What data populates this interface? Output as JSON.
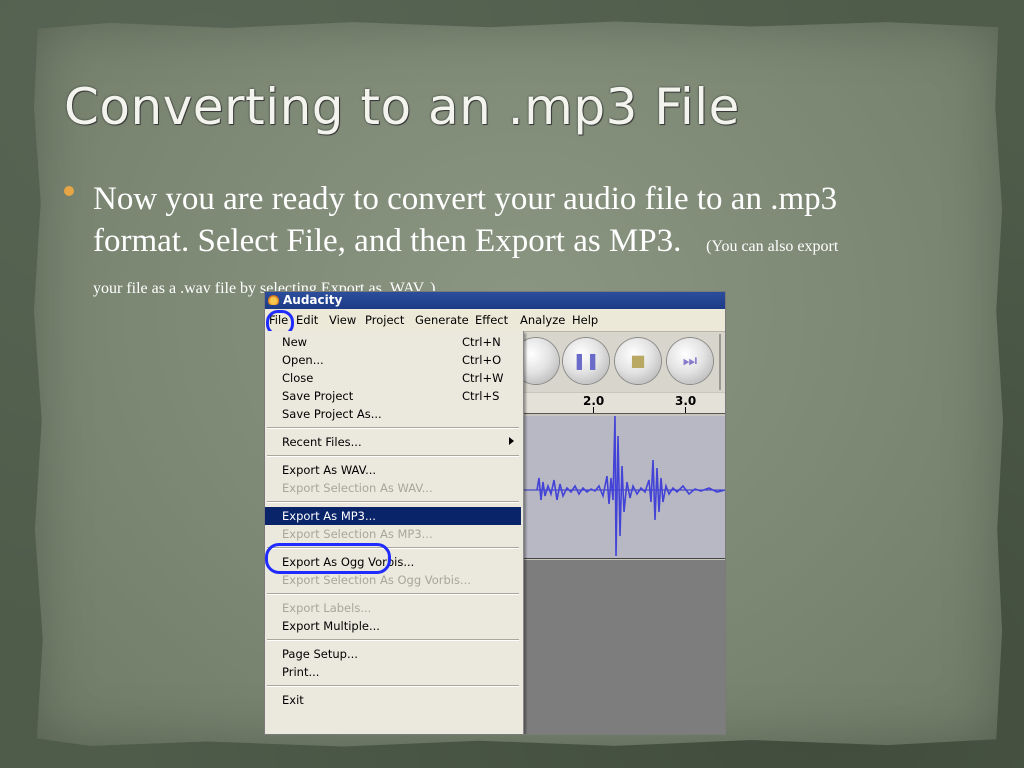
{
  "slide": {
    "title": "Converting to an .mp3 File",
    "bullet_line1": "Now you are ready to convert your audio file to an .mp3",
    "bullet_line2": "format.  Select File, and then Export as MP3.",
    "bullet_note_a": "(You can also export",
    "bullet_note_b": "your file as a .wav file by selecting Export as .WAV. )",
    "bullet_color": "#e7a545"
  },
  "app": {
    "title": "Audacity",
    "menus": [
      "File",
      "Edit",
      "View",
      "Project",
      "Generate",
      "Effect",
      "Analyze",
      "Help"
    ],
    "ruler_ticks": [
      "2.0",
      "3.0"
    ],
    "file_menu": {
      "new": "New",
      "new_sc": "Ctrl+N",
      "open": "Open...",
      "open_sc": "Ctrl+O",
      "close": "Close",
      "close_sc": "Ctrl+W",
      "save": "Save Project",
      "save_sc": "Ctrl+S",
      "save_as": "Save Project As...",
      "recent": "Recent Files...",
      "export_wav": "Export As WAV...",
      "export_sel_wav": "Export Selection As WAV...",
      "export_mp3": "Export As MP3...",
      "export_sel_mp3": "Export Selection As MP3...",
      "export_ogg": "Export As Ogg Vorbis...",
      "export_sel_ogg": "Export Selection As Ogg Vorbis...",
      "export_labels": "Export Labels...",
      "export_multiple": "Export Multiple...",
      "page_setup": "Page Setup...",
      "print": "Print...",
      "exit": "Exit"
    },
    "highlight_color": "#1f2bff",
    "selected_color": "#0a246a"
  }
}
